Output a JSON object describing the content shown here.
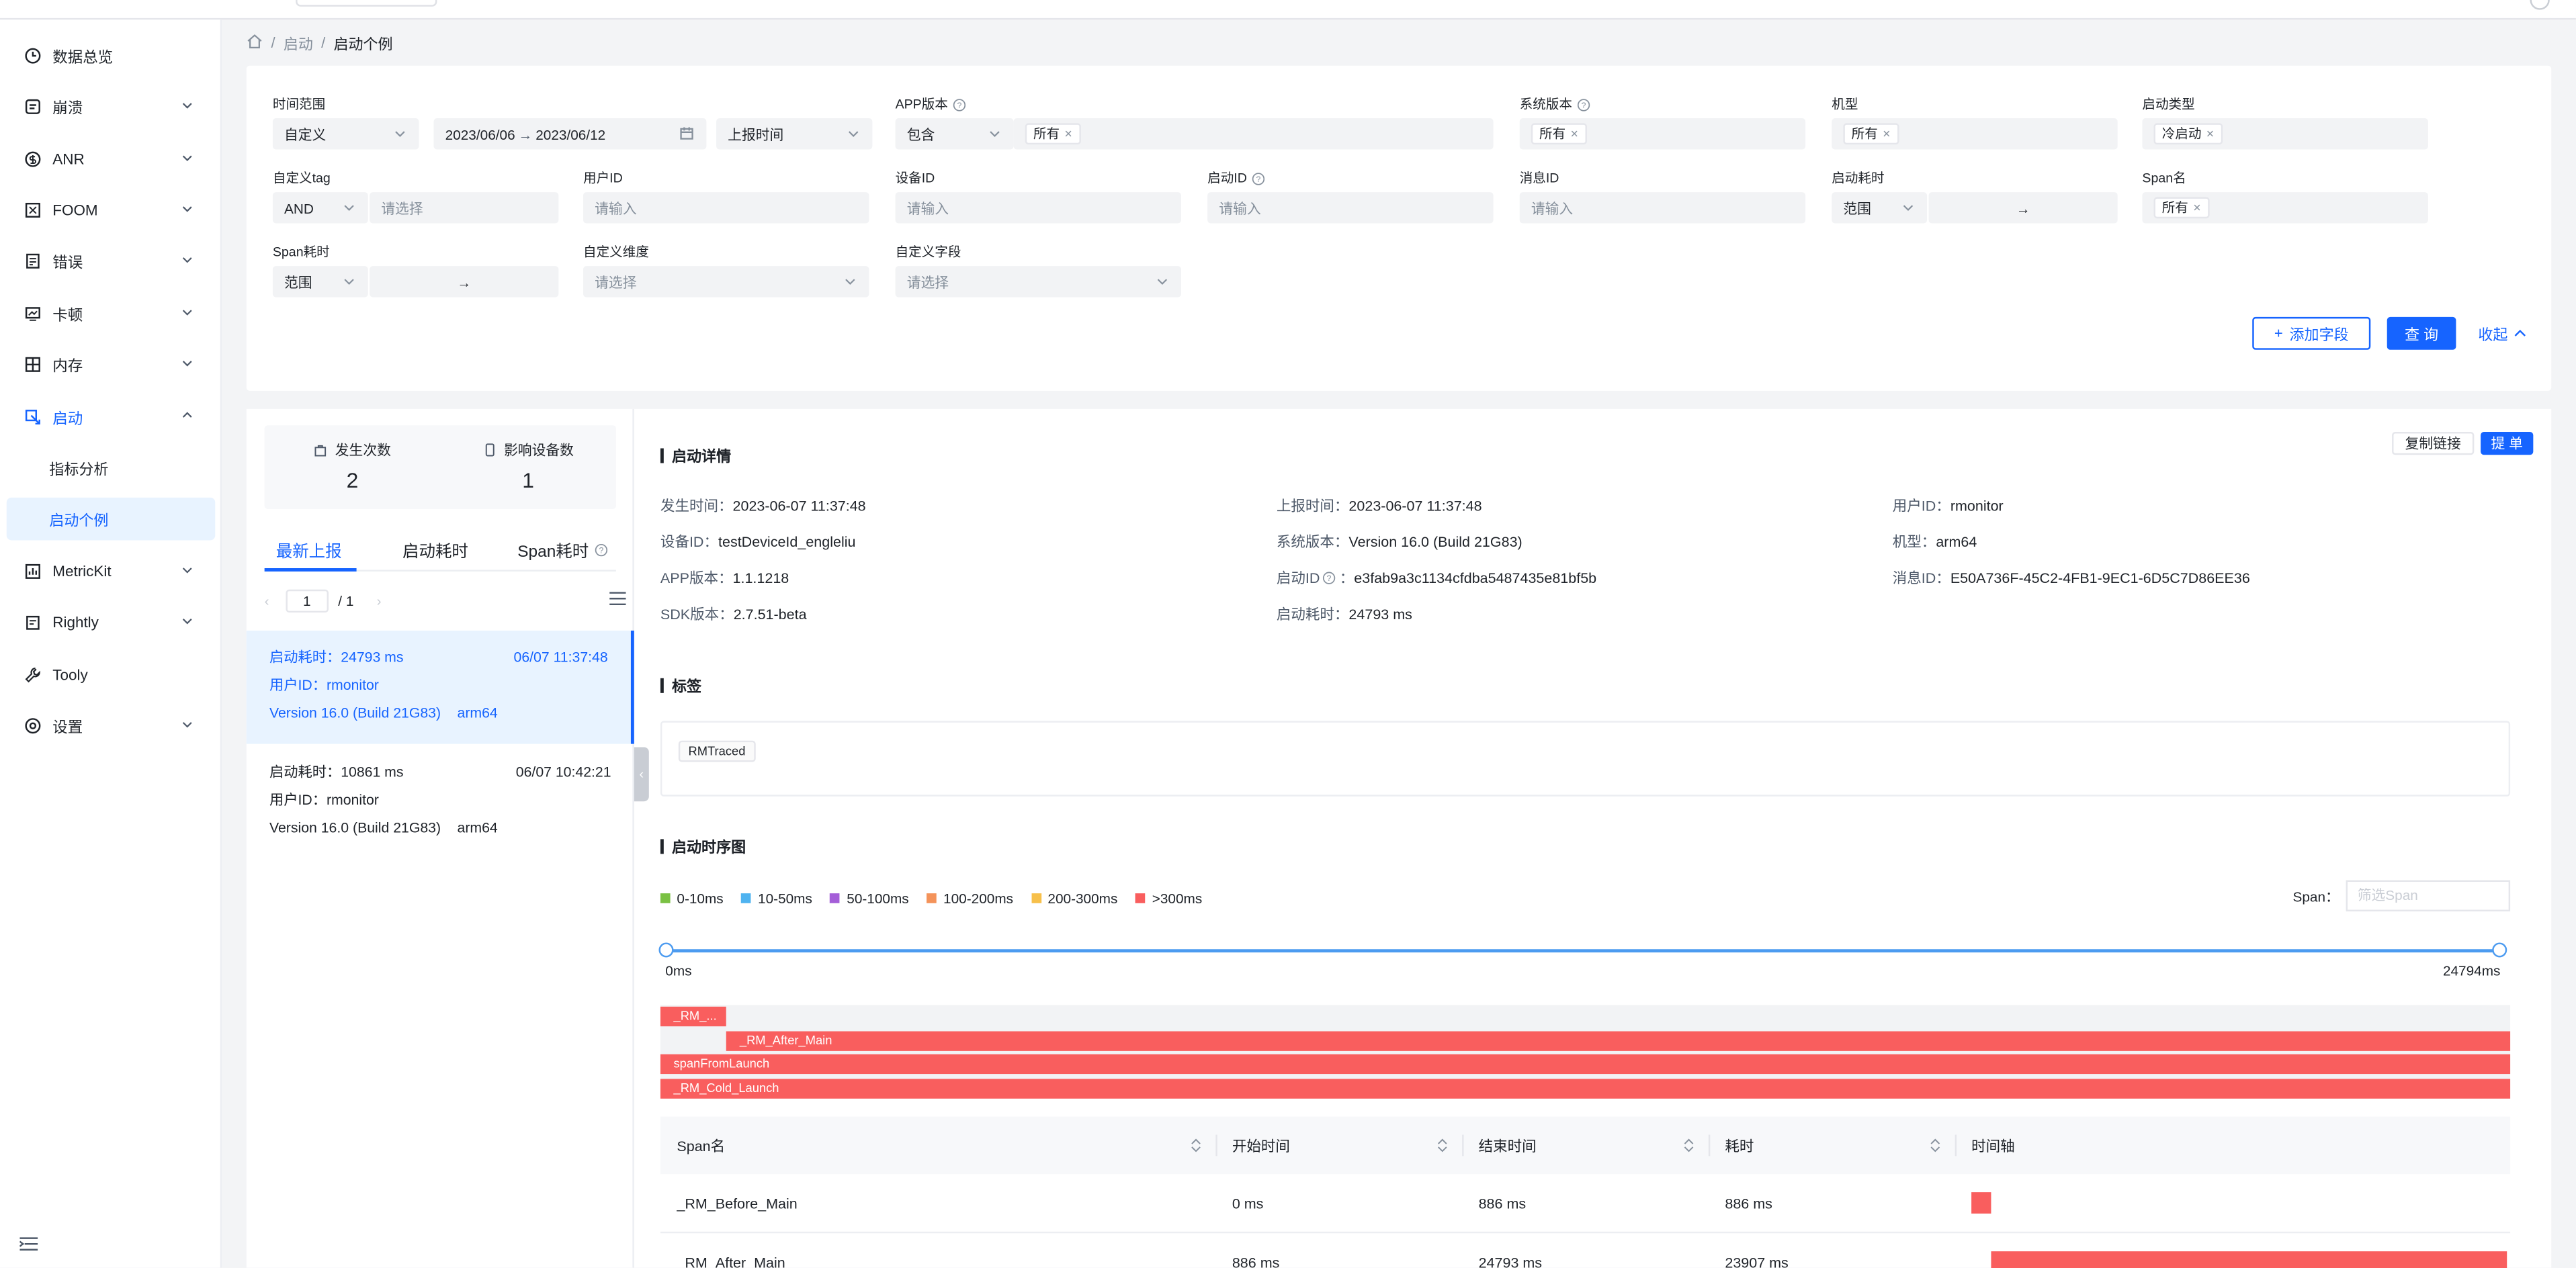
{
  "sidebar": {
    "items": [
      {
        "label": "数据总览",
        "icon": "clock-icon"
      },
      {
        "label": "崩溃",
        "icon": "bug-icon"
      },
      {
        "label": "ANR",
        "icon": "dollar-circle-icon"
      },
      {
        "label": "FOOM",
        "icon": "memory-box-icon"
      },
      {
        "label": "错误",
        "icon": "error-doc-icon"
      },
      {
        "label": "卡顿",
        "icon": "monitor-icon"
      },
      {
        "label": "内存",
        "icon": "grid-icon"
      },
      {
        "label": "启动",
        "icon": "launch-icon"
      },
      {
        "label": "MetricKit",
        "icon": "metric-icon"
      },
      {
        "label": "Rightly",
        "icon": "clipboard-icon"
      },
      {
        "label": "Tooly",
        "icon": "wrench-icon"
      },
      {
        "label": "设置",
        "icon": "settings-icon"
      }
    ],
    "sub_items": [
      "指标分析",
      "启动个例"
    ]
  },
  "breadcrumb": {
    "items": [
      "启动",
      "启动个例"
    ]
  },
  "filters": {
    "time_range": {
      "label": "时间范围",
      "mode": "自定义",
      "start": "2023/06/06",
      "end": "2023/06/12",
      "type": "上报时间"
    },
    "app_version": {
      "label": "APP版本",
      "op": "包含",
      "tag": "所有"
    },
    "sys_version": {
      "label": "系统版本",
      "tag": "所有"
    },
    "model": {
      "label": "机型",
      "tag": "所有"
    },
    "launch_type": {
      "label": "启动类型",
      "tag": "冷启动"
    },
    "custom_tag": {
      "label": "自定义tag",
      "op": "AND",
      "placeholder": "请选择"
    },
    "user_id": {
      "label": "用户ID",
      "placeholder": "请输入"
    },
    "device_id": {
      "label": "设备ID",
      "placeholder": "请输入"
    },
    "launch_id": {
      "label": "启动ID",
      "placeholder": "请输入"
    },
    "msg_id": {
      "label": "消息ID",
      "placeholder": "请输入"
    },
    "launch_cost": {
      "label": "启动耗时",
      "op": "范围",
      "arrow": "→"
    },
    "span_name": {
      "label": "Span名",
      "tag": "所有"
    },
    "span_cost": {
      "label": "Span耗时",
      "op": "范围",
      "arrow": "→"
    },
    "custom_dim": {
      "label": "自定义维度",
      "placeholder": "请选择"
    },
    "custom_field": {
      "label": "自定义字段",
      "placeholder": "请选择"
    },
    "add_field": "添加字段",
    "query": "查 询",
    "collapse": "收起"
  },
  "stats": {
    "occur_label": "发生次数",
    "occur": "2",
    "devices_label": "影响设备数",
    "devices": "1"
  },
  "list_tabs": [
    "最新上报",
    "启动耗时",
    "Span耗时"
  ],
  "pager": {
    "page": "1",
    "total": "/ 1"
  },
  "records": [
    {
      "cost": "启动耗时：24793 ms",
      "time": "06/07 11:37:48",
      "user": "用户ID：rmonitor",
      "version": "Version 16.0 (Build 21G83)",
      "arch": "arm64"
    },
    {
      "cost": "启动耗时：10861 ms",
      "time": "06/07 10:42:21",
      "user": "用户ID：rmonitor",
      "version": "Version 16.0 (Build 21G83)",
      "arch": "arm64"
    }
  ],
  "detail": {
    "title": "启动详情",
    "copy_link": "复制链接",
    "submit": "提 单",
    "fields": [
      {
        "k": "发生时间：",
        "v": "2023-06-07 11:37:48"
      },
      {
        "k": "上报时间：",
        "v": "2023-06-07 11:37:48"
      },
      {
        "k": "用户ID：",
        "v": "rmonitor"
      },
      {
        "k": "设备ID：",
        "v": "testDeviceId_engleliu"
      },
      {
        "k": "系统版本：",
        "v": "Version 16.0 (Build 21G83)"
      },
      {
        "k": "机型：",
        "v": "arm64"
      },
      {
        "k": "APP版本：",
        "v": "1.1.1218"
      },
      {
        "k": "启动ID",
        "v": "e3fab9a3c1134cfdba5487435e81bf5b"
      },
      {
        "k": "消息ID：",
        "v": "E50A736F-45C2-4FB1-9EC1-6D5C7D86EE36"
      },
      {
        "k": "SDK版本：",
        "v": "2.7.51-beta"
      },
      {
        "k": "启动耗时：",
        "v": "24793 ms"
      }
    ],
    "launch_id_colon": "：",
    "tags_title": "标签",
    "tags": [
      "RMTraced"
    ],
    "timeline_title": "启动时序图",
    "legend": [
      {
        "label": "0-10ms",
        "color": "#7ac143"
      },
      {
        "label": "10-50ms",
        "color": "#4fb3f0"
      },
      {
        "label": "50-100ms",
        "color": "#a45ed8"
      },
      {
        "label": "100-200ms",
        "color": "#f4935a"
      },
      {
        "label": "200-300ms",
        "color": "#f7c04a"
      },
      {
        "label": ">300ms",
        "color": "#f95e5e"
      }
    ],
    "span_filter_label": "Span：",
    "span_filter_placeholder": "筛选Span",
    "axis_start": "0ms",
    "axis_end": "24794ms",
    "total_ms": 24794,
    "gantt": [
      {
        "label": "_RM_...",
        "start": 0,
        "end": 886
      },
      {
        "label": "_RM_After_Main",
        "start": 886,
        "end": 24793
      },
      {
        "label": "spanFromLaunch",
        "start": 0,
        "end": 24793
      },
      {
        "label": "_RM_Cold_Launch",
        "start": 0,
        "end": 24793
      }
    ],
    "table_headers": [
      "Span名",
      "开始时间",
      "结束时间",
      "耗时",
      "时间轴"
    ],
    "rows": [
      {
        "name": "_RM_Before_Main",
        "start": "0 ms",
        "end": "886 ms",
        "cost": "886 ms",
        "s": 0,
        "e": 886
      },
      {
        "name": "_RM_After_Main",
        "start": "886 ms",
        "end": "24793 ms",
        "cost": "23907 ms",
        "s": 886,
        "e": 24793
      }
    ]
  }
}
